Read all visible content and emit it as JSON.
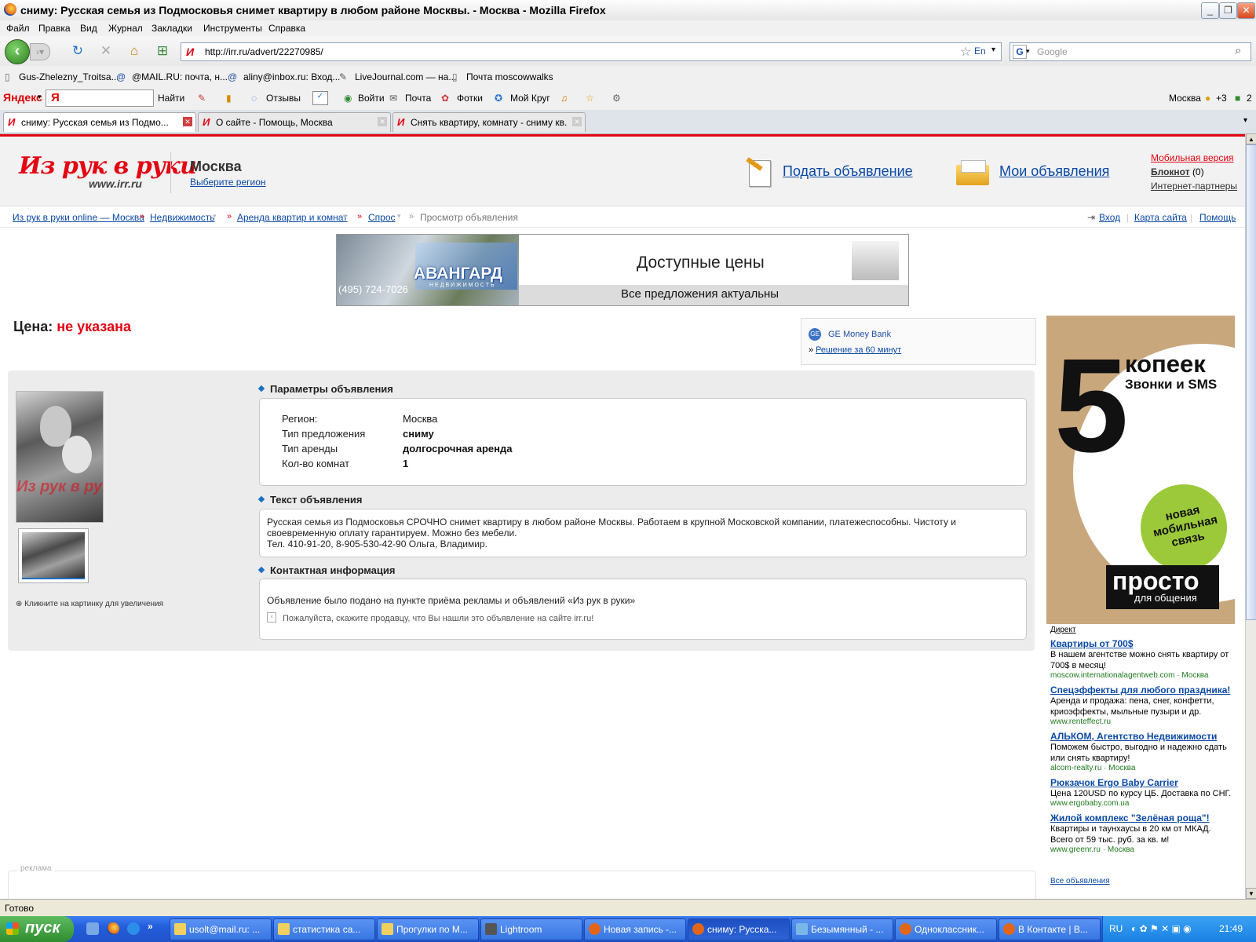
{
  "window": {
    "title": "сниму: Русская семья из Подмосковья снимет квартиру в любом районе Москвы. - Москва - Mozilla Firefox"
  },
  "menu": [
    "Файл",
    "Правка",
    "Вид",
    "Журнал",
    "Закладки",
    "Инструменты",
    "Справка"
  ],
  "nav": {
    "url": "http://irr.ru/advert/22270985/",
    "search_placeholder": "Google",
    "lang": "En"
  },
  "bookmarks": [
    "Gus-Zhelezny_Troitsa...",
    "@MAIL.RU: почта, н...",
    "aliny@inbox.ru: Вход...",
    "LiveJournal.com — на...",
    "Почта moscowwalks"
  ],
  "yandex": {
    "brand": "Яндекс",
    "input": "Я",
    "find": "Найти",
    "reviews": "Отзывы",
    "login": "Войти",
    "mail": "Почта",
    "photos": "Фотки",
    "mykrug": "Мой Круг",
    "city": "Москва",
    "weather": "+3",
    "count": "2"
  },
  "tabs": [
    {
      "label": "сниму: Русская семья из Подмо...",
      "active": true
    },
    {
      "label": "О сайте - Помощь, Москва",
      "active": false
    },
    {
      "label": "Снять квартиру, комнату - сниму кв...",
      "active": false
    }
  ],
  "header": {
    "logo": "Из рук в руки",
    "logo_sub": "www.irr.ru",
    "city": "Москва",
    "choose_region": "Выберите регион",
    "submit_ad": "Подать объявление",
    "my_ads": "Мои объявления",
    "mobile": "Мобильная версия",
    "notepad": "Блокнот",
    "notepad_count": "(0)",
    "partners": "Интернет-партнеры"
  },
  "breadcrumbs": [
    "Из рук в руки online — Москва",
    "Недвижимость",
    "Аренда квартир и комнат",
    "Спрос",
    "Просмотр объявления"
  ],
  "user_links": [
    "Вход",
    "Карта сайта",
    "Помощь"
  ],
  "banner": {
    "brand": "АВАНГАРД",
    "brand_sub": "НЕДВИЖИМОСТЬ",
    "phone": "(495) 724-7026",
    "headline": "Доступные цены",
    "subline": "Все предложения актуальны"
  },
  "price": {
    "label": "Цена:",
    "value": "не указана"
  },
  "ge_ad": {
    "title": "GE Money Bank",
    "link": "Решение за 60 минут"
  },
  "photo": {
    "watermark": "Из рук в руки",
    "zoom_hint": "Кликните на картинку для увеличения"
  },
  "params": {
    "heading": "Параметры объявления",
    "rows": [
      {
        "label": "Регион:",
        "value": "Москва"
      },
      {
        "label": "Тип предложения",
        "value": "сниму"
      },
      {
        "label": "Тип аренды",
        "value": "долгосрочная аренда"
      },
      {
        "label": "Кол-во комнат",
        "value": "1"
      }
    ]
  },
  "ad_text": {
    "heading": "Текст объявления",
    "line1": "Русская семья из Подмосковья СРОЧНО снимет квартиру в любом районе Москвы. Работаем в крупной Московской компании, платежеспособны. Чистоту и",
    "line2": "своевременную оплату гарантируем. Можно без мебели.",
    "line3": "Тел. 410-91-20, 8-905-530-42-90 Ольга, Владимир."
  },
  "contact": {
    "heading": "Контактная информация",
    "text": "Объявление было подано на пункте приёма рекламы и объявлений «Из рук в руки»",
    "hint": "Пожалуйста, скажите продавцу, что Вы нашли это объявление на сайте irr.ru!"
  },
  "mobile_ad": {
    "big": "5",
    "kopeek": "копеек",
    "calls": "Звонки и SMS",
    "green": "новая мобильная связь",
    "prosto": "просто",
    "for_talk": "для общения"
  },
  "direct": {
    "label": "Директ",
    "ads": [
      {
        "title": "Квартиры от 700$",
        "text": "В нашем агентстве можно снять квартиру от 700$ в месяц!",
        "url": "moscow.internationalagentweb.com",
        "region": "Москва"
      },
      {
        "title": "Спецэффекты для любого праздника!",
        "text": "Аренда и продажа: пена, снег, конфетти, криоэффекты, мыльные пузыри и др.",
        "url": "www.renteffect.ru",
        "region": ""
      },
      {
        "title": "АЛЬКОМ, Агентство Недвижимости",
        "text": "Поможем быстро, выгодно и надежно сдать или снять квартиру!",
        "url": "alcom-realty.ru",
        "region": "Москва"
      },
      {
        "title": "Рюкзачок Ergo Baby Carrier",
        "text": "Цена 120USD по курсу ЦБ. Доставка по СНГ.",
        "url": "www.ergobaby.com.ua",
        "region": ""
      },
      {
        "title": "Жилой комплекс \"Зелёная роща\"!",
        "text": "Квартиры и таунхаусы в 20 км от МКАД. Всего от 59 тыс. руб. за кв. м!",
        "url": "www.greenr.ru",
        "region": "Москва"
      }
    ],
    "all": "Все объявления"
  },
  "footer_ad_label": "реклама",
  "status": "Готово",
  "taskbar": {
    "start": "пуск",
    "tasks": [
      "usolt@mail.ru: ...",
      "статистика са...",
      "Прогулки по М...",
      "Lightroom",
      "Новая запись -...",
      "сниму: Русска...",
      "Безымянный - ...",
      "Одноклассник...",
      "В Контакте | В..."
    ],
    "lang": "RU",
    "time": "21:49"
  },
  "colors": {
    "brand_red": "#e30613",
    "link": "#0b49a5",
    "xp_blue": "#245edb"
  }
}
